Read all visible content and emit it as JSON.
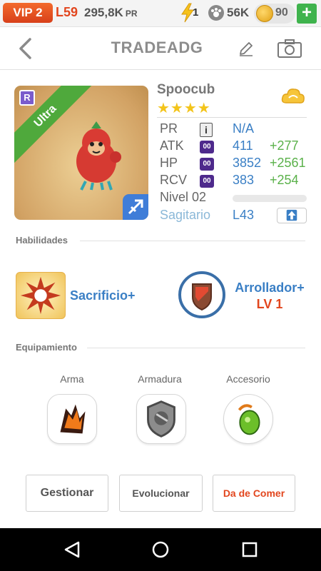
{
  "status": {
    "vip": "VIP 2",
    "level": "L59",
    "power": "295,8K",
    "power_unit": "PR",
    "energy": "1",
    "paws": "56K",
    "coins": "90",
    "add": "+"
  },
  "header": {
    "title": "TRADEADG",
    "icons": [
      "back-icon",
      "edit-icon",
      "camera-icon"
    ]
  },
  "card": {
    "rarity_letter": "R",
    "rarity_label": "Ultra",
    "element_icon": "sagittarius-icon"
  },
  "pet": {
    "name": "Spoocub",
    "stars": "★★★★",
    "stats": [
      {
        "label": "PR",
        "badge": "i",
        "value": "N/A",
        "bonus": ""
      },
      {
        "label": "ATK",
        "badge": "00",
        "value": "411",
        "bonus": "+277"
      },
      {
        "label": "HP",
        "badge": "00",
        "value": "3852",
        "bonus": "+2561"
      },
      {
        "label": "RCV",
        "badge": "00",
        "value": "383",
        "bonus": "+254"
      }
    ],
    "level_text": "Nivel 02",
    "level_progress": 0,
    "zodiac": "Sagitario",
    "zodiac_level": "L43"
  },
  "sections": {
    "skills": "Habilidades",
    "equipment": "Equipamiento"
  },
  "skills": [
    {
      "name": "Sacrificio+",
      "icon": "explosion-icon"
    },
    {
      "name": "Arrollador+",
      "level": "LV 1",
      "icon": "shield-icon"
    }
  ],
  "equipment": [
    {
      "label": "Arma",
      "icon": "claw-weapon-icon"
    },
    {
      "label": "Armadura",
      "icon": "armor-icon"
    },
    {
      "label": "Accesorio",
      "icon": "green-gem-icon"
    }
  ],
  "buttons": {
    "manage": "Gestionar",
    "evolve": "Evolucionar",
    "feed": "Da de Comer"
  },
  "colors": {
    "accent_orange": "#e2461e",
    "stat_blue": "#3a7fc5",
    "bonus_green": "#5ab14a",
    "star_yellow": "#f3c41a"
  }
}
